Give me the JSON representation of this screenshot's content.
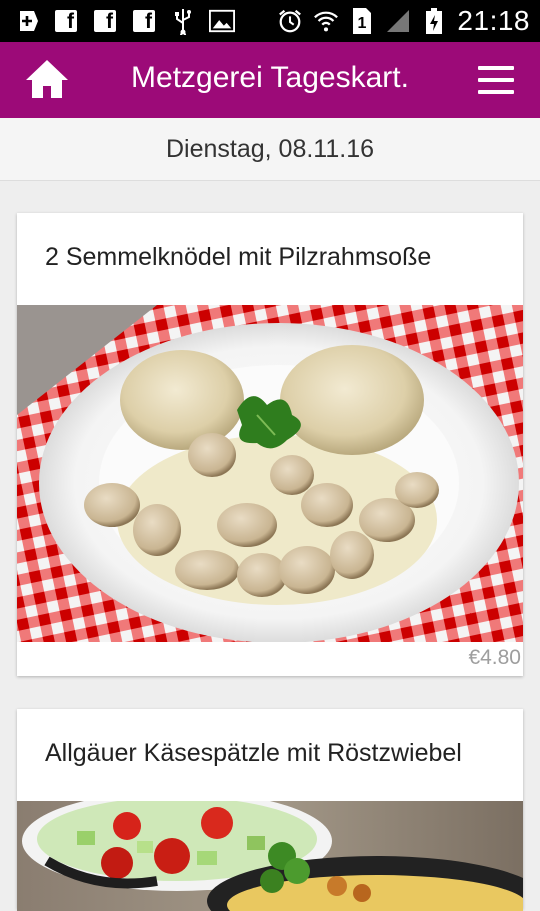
{
  "status_bar": {
    "time": "21:18",
    "left_icons": [
      "add-box-icon",
      "facebook-icon",
      "facebook-icon",
      "facebook-icon",
      "usb-icon",
      "image-icon"
    ],
    "right_icons": [
      "alarm-icon",
      "wifi-icon",
      "sim-1-icon",
      "signal-icon",
      "battery-charging-icon"
    ]
  },
  "app_bar": {
    "title": "Metzgerei Tageskart.",
    "color": "#9c0a78"
  },
  "date_header": "Dienstag, 08.11.16",
  "menu_items": [
    {
      "name": "2 Semmelknödel mit Pilzrahmsoße",
      "price": "€4.80"
    },
    {
      "name": "Allgäuer Käsespätzle mit Röstzwiebel",
      "price": ""
    }
  ]
}
